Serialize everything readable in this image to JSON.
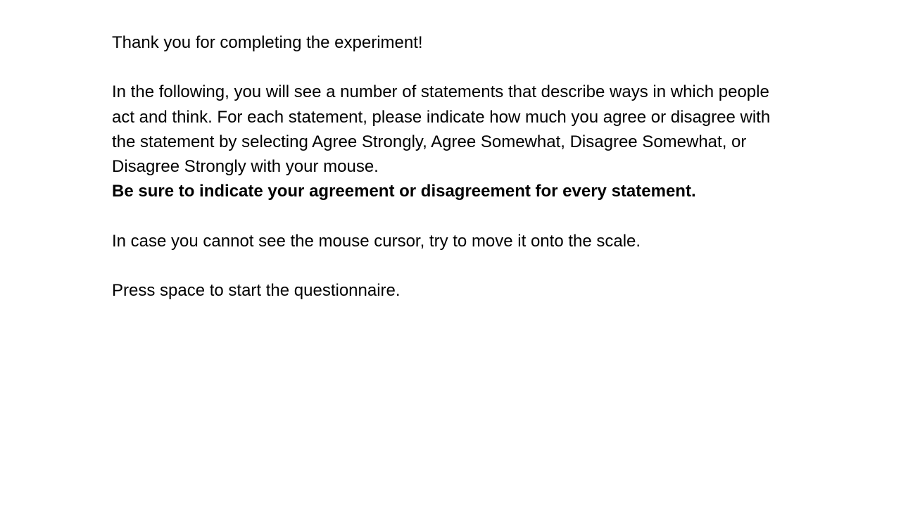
{
  "instructions": {
    "thanks": "Thank you for completing the experiment!",
    "description": "In the following, you will see a number of statements that describe ways in which people act and think. For each statement, please indicate how much you agree or disagree with the statement by selecting Agree Strongly, Agree Somewhat, Disagree Somewhat, or Disagree Strongly with your mouse.",
    "emphasis": "Be sure to indicate your agreement or disagreement for every statement.",
    "cursor_hint": "In case you cannot see the mouse cursor, try to move it onto the scale.",
    "start_prompt": "Press space to start the questionnaire."
  }
}
